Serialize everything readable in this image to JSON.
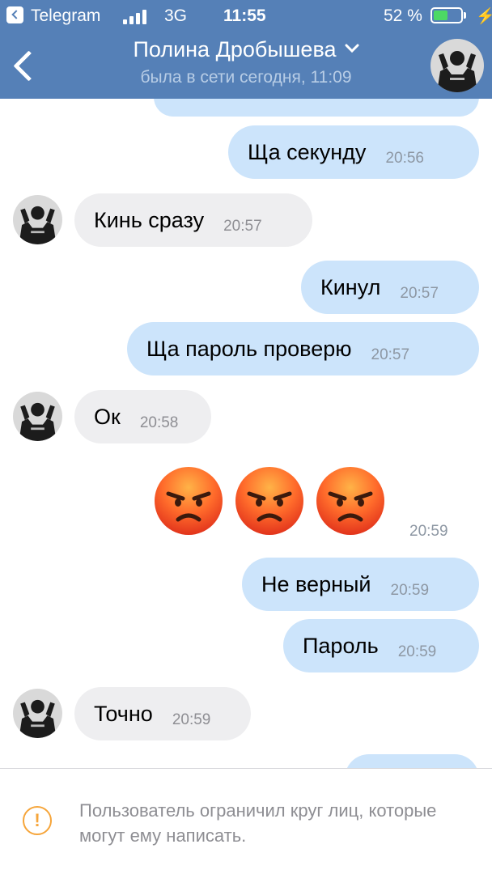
{
  "status_bar": {
    "back_app": "Telegram",
    "network": "3G",
    "time": "11:55",
    "battery_percent": "52 %",
    "battery_level": 0.52,
    "signal_bars": 4
  },
  "nav": {
    "title": "Полина Дробышева",
    "subtitle": "была в сети сегодня, 11:09"
  },
  "messages": [
    {
      "dir": "out",
      "text": "Ща секунду",
      "time": "20:56"
    },
    {
      "dir": "in",
      "text": "Кинь сразу",
      "time": "20:57"
    },
    {
      "dir": "out",
      "text": "Кинул",
      "time": "20:57"
    },
    {
      "dir": "out",
      "text": "Ща пароль проверю",
      "time": "20:57"
    },
    {
      "dir": "in",
      "text": "Ок",
      "time": "20:58"
    },
    {
      "dir": "out",
      "text": "Не верный",
      "time": "20:59"
    },
    {
      "dir": "out",
      "text": "Пароль",
      "time": "20:59"
    },
    {
      "dir": "in",
      "text": "Точно",
      "time": "20:59"
    }
  ],
  "emoji_message": {
    "emojis": [
      "angry-face-icon",
      "angry-face-icon",
      "angry-face-icon"
    ],
    "time": "20:59"
  },
  "notice": {
    "text": "Пользователь ограничил круг лиц, которые могут ему написать."
  },
  "colors": {
    "header": "#5580b7",
    "outgoing_bubble": "#cce4fb",
    "incoming_bubble": "#eeeef0",
    "warning": "#f6a53a"
  }
}
